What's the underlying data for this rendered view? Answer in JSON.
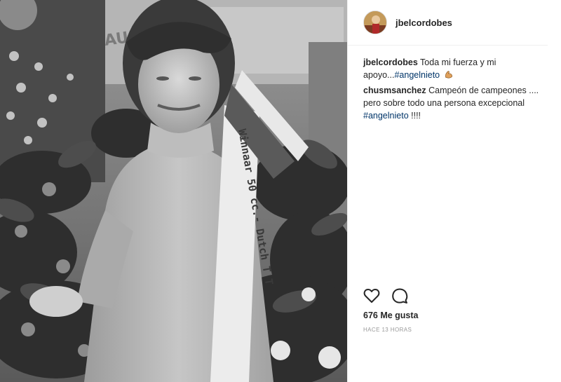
{
  "header": {
    "username": "jbelcordobes"
  },
  "comments": [
    {
      "user": "jbelcordobes",
      "text": "Toda mi fuerza y mi apoyo...",
      "hashtag": "#angelnieto",
      "emoji": "flexed-biceps-icon"
    },
    {
      "user": "chusmsanchez",
      "text": "Campeón de campeones .... pero sobre todo una persona excepcional",
      "hashtag": "#angelnieto",
      "suffix": " !!!!"
    }
  ],
  "actions": {
    "like_icon": "heart-icon",
    "comment_icon": "comment-icon"
  },
  "likes": "676 Me gusta",
  "timestamp": "HACE 13 HORAS",
  "photo": {
    "sash_text": "Winnaar 50 cc.- Dutch T T",
    "sign_text": "AU        PLASI"
  },
  "colors": {
    "text": "#262626",
    "hashtag": "#003569",
    "muted": "#999999",
    "border": "#efefef"
  }
}
